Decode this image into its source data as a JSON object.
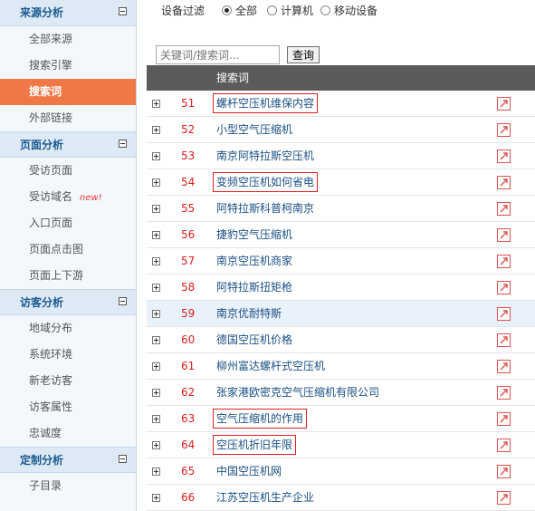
{
  "sidebar": {
    "sections": [
      {
        "title": "来源分析",
        "items": [
          {
            "label": "全部来源"
          },
          {
            "label": "搜索引擎"
          },
          {
            "label": "搜索词",
            "active": true
          },
          {
            "label": "外部链接"
          }
        ]
      },
      {
        "title": "页面分析",
        "items": [
          {
            "label": "受访页面"
          },
          {
            "label": "受访域名",
            "badge": "new!"
          },
          {
            "label": "入口页面"
          },
          {
            "label": "页面点击图"
          },
          {
            "label": "页面上下游"
          }
        ]
      },
      {
        "title": "访客分析",
        "items": [
          {
            "label": "地域分布"
          },
          {
            "label": "系统环境"
          },
          {
            "label": "新老访客"
          },
          {
            "label": "访客属性"
          },
          {
            "label": "忠诚度"
          }
        ]
      },
      {
        "title": "定制分析",
        "items": [
          {
            "label": "子目录"
          }
        ]
      }
    ]
  },
  "filter": {
    "label": "设备过滤",
    "options": [
      {
        "label": "全部",
        "checked": true
      },
      {
        "label": "计算机",
        "checked": false
      },
      {
        "label": "移动设备",
        "checked": false
      }
    ]
  },
  "search": {
    "placeholder": "关键词/搜索词...",
    "button_label": "查询"
  },
  "table": {
    "header": "搜索词",
    "rows": [
      {
        "num": "51",
        "keyword": "螺杆空压机维保内容",
        "highlighted": true
      },
      {
        "num": "52",
        "keyword": "小型空气压缩机",
        "highlighted": false
      },
      {
        "num": "53",
        "keyword": "南京阿特拉斯空压机",
        "highlighted": false
      },
      {
        "num": "54",
        "keyword": "变频空压机如何省电",
        "highlighted": true
      },
      {
        "num": "55",
        "keyword": "阿特拉斯科普柯南京",
        "highlighted": false
      },
      {
        "num": "56",
        "keyword": "捷豹空气压缩机",
        "highlighted": false
      },
      {
        "num": "57",
        "keyword": "南京空压机商家",
        "highlighted": false
      },
      {
        "num": "58",
        "keyword": "阿特拉斯扭矩枪",
        "highlighted": false
      },
      {
        "num": "59",
        "keyword": "南京优耐特斯",
        "highlighted": false,
        "hover": true
      },
      {
        "num": "60",
        "keyword": "德国空压机价格",
        "highlighted": false
      },
      {
        "num": "61",
        "keyword": "柳州富达螺杆式空压机",
        "highlighted": false
      },
      {
        "num": "62",
        "keyword": "张家港欧密克空气压缩机有限公司",
        "highlighted": false
      },
      {
        "num": "63",
        "keyword": "空气压缩机的作用",
        "highlighted": true
      },
      {
        "num": "64",
        "keyword": "空压机折旧年限",
        "highlighted": true
      },
      {
        "num": "65",
        "keyword": "中国空压机网",
        "highlighted": false
      },
      {
        "num": "66",
        "keyword": "江苏空压机生产企业",
        "highlighted": false
      }
    ]
  }
}
